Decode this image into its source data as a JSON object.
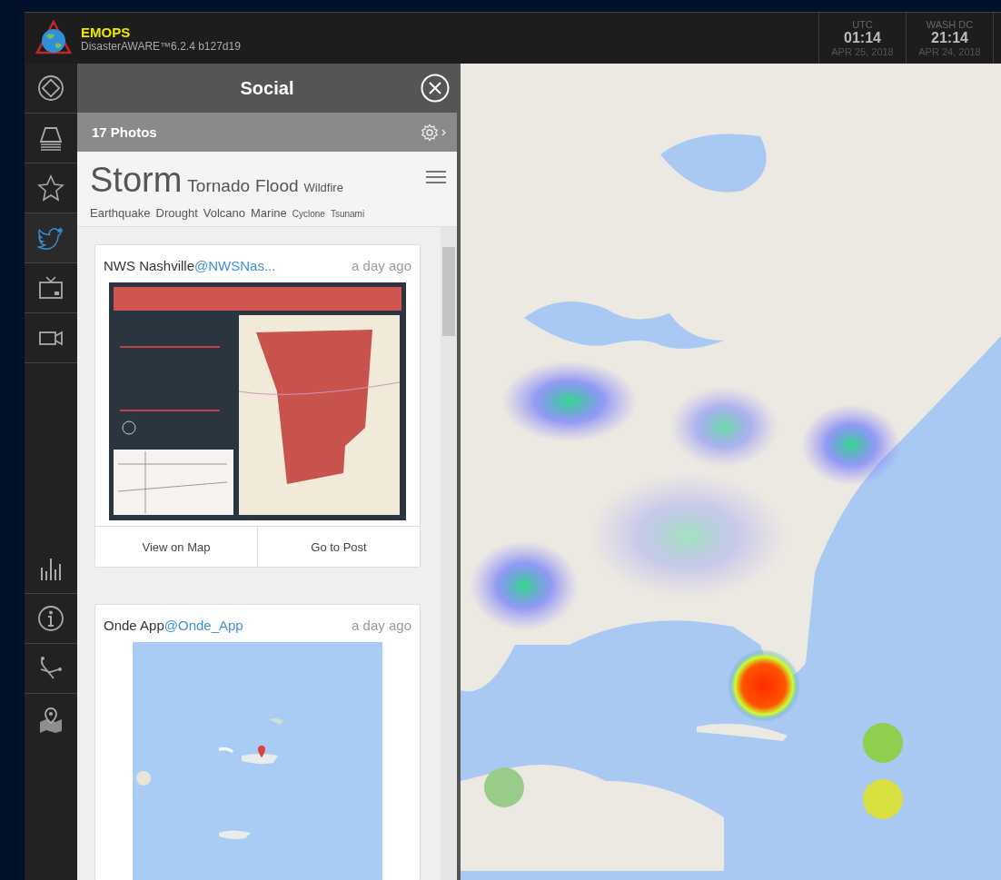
{
  "app": {
    "name": "EMOPS",
    "version": "DisasterAWARE™6.2.4 b127d19"
  },
  "clocks": [
    {
      "zone": "UTC",
      "time": "01:14",
      "date": "APR 25, 2018"
    },
    {
      "zone": "WASH DC",
      "time": "21:14",
      "date": "APR 24, 2018"
    }
  ],
  "rail": {
    "top": [
      {
        "kind": "diamond",
        "selected": false
      },
      {
        "kind": "layers",
        "selected": false
      },
      {
        "kind": "star",
        "selected": false
      },
      {
        "kind": "bird",
        "selected": true
      },
      {
        "kind": "tv",
        "selected": false
      },
      {
        "kind": "camera",
        "selected": false
      }
    ],
    "bottom": [
      {
        "kind": "bars",
        "selected": false
      },
      {
        "kind": "info",
        "selected": false
      },
      {
        "kind": "route",
        "selected": false
      },
      {
        "kind": "mappin",
        "selected": false
      }
    ]
  },
  "panel": {
    "title": "Social",
    "count": "17 Photos",
    "topics": [
      {
        "label": "Storm",
        "kind": "large"
      },
      {
        "label": "Tornado",
        "kind": "medium"
      },
      {
        "label": "Flood",
        "kind": "medium"
      },
      {
        "label": "Wildfire",
        "kind": "small"
      },
      {
        "label": "Earthquake",
        "kind": "small"
      },
      {
        "label": "Drought",
        "kind": "small"
      },
      {
        "label": "Volcano",
        "kind": "small"
      },
      {
        "label": "Marine",
        "kind": "small"
      },
      {
        "label": "Cyclone",
        "kind": "tiny"
      },
      {
        "label": "Tsunami",
        "kind": "tiny"
      }
    ],
    "posts": [
      {
        "author": "NWS Nashville",
        "handle": "@NWSNas...",
        "time": "a day ago",
        "actions": [
          "View on Map",
          "Go to Post"
        ]
      },
      {
        "author": "Onde App",
        "handle": "@Onde_App",
        "time": "a day ago"
      }
    ]
  }
}
